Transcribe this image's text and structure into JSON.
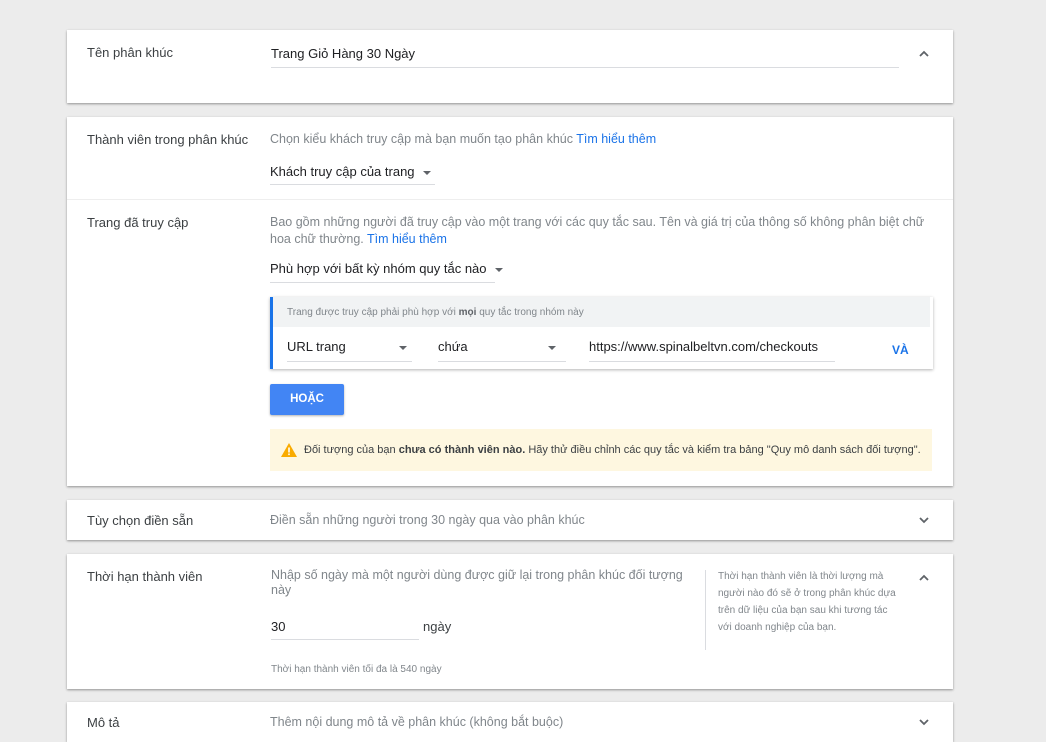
{
  "segment_name": {
    "label": "Tên phân khúc",
    "value": "Trang Giỏ Hàng 30 Ngày"
  },
  "members": {
    "label": "Thành viên trong phân khúc",
    "description": "Chọn kiểu khách truy cập mà bạn muốn tạo phân khúc",
    "learn_more": "Tìm hiểu thêm",
    "visitor_type": "Khách truy cập của trang"
  },
  "visited_page": {
    "label": "Trang đã truy cập",
    "description": "Bao gồm những người đã truy cập vào một trang với các quy tắc sau. Tên và giá trị của thông số không phân biệt chữ hoa chữ thường.",
    "learn_more": "Tìm hiểu thêm",
    "match_mode": "Phù hợp với bất kỳ nhóm quy tắc nào",
    "rule_group": {
      "header_prefix": "Trang được truy cập phải phù hợp với",
      "header_bold": "mọi",
      "header_suffix": "quy tắc trong nhóm này",
      "field": "URL trang",
      "operator": "chứa",
      "value": "https://www.spinalbeltvn.com/checkouts",
      "and_label": "VÀ"
    },
    "or_button": "HOẶC",
    "warning": {
      "prefix": "Đối tượng của bạn",
      "bold": "chưa có thành viên nào.",
      "suffix": "Hãy thử điều chỉnh các quy tắc và kiểm tra bảng \"Quy mô danh sách đối tượng\"."
    }
  },
  "prefill": {
    "label": "Tùy chọn điền sẵn",
    "description": "Điền sẵn những người trong 30 ngày qua vào phân khúc"
  },
  "duration": {
    "label": "Thời hạn thành viên",
    "description": "Nhập số ngày mà một người dùng được giữ lại trong phân khúc đối tượng này",
    "value": "30",
    "unit": "ngày",
    "max_note": "Thời hạn thành viên tối đa là 540 ngày",
    "help_text": "Thời hạn thành viên là thời lượng mà người nào đó sẽ ở trong phân khúc dựa trên dữ liệu của bạn sau khi tương tác với doanh nghiệp của bạn."
  },
  "description_section": {
    "label": "Mô tả",
    "placeholder": "Thêm nội dung mô tả về phân khúc (không bắt buộc)"
  },
  "colors": {
    "accent": "#1a73e8",
    "button": "#4285f4",
    "warning_bg": "#fef7e0",
    "warning_icon": "#f9ab00"
  }
}
